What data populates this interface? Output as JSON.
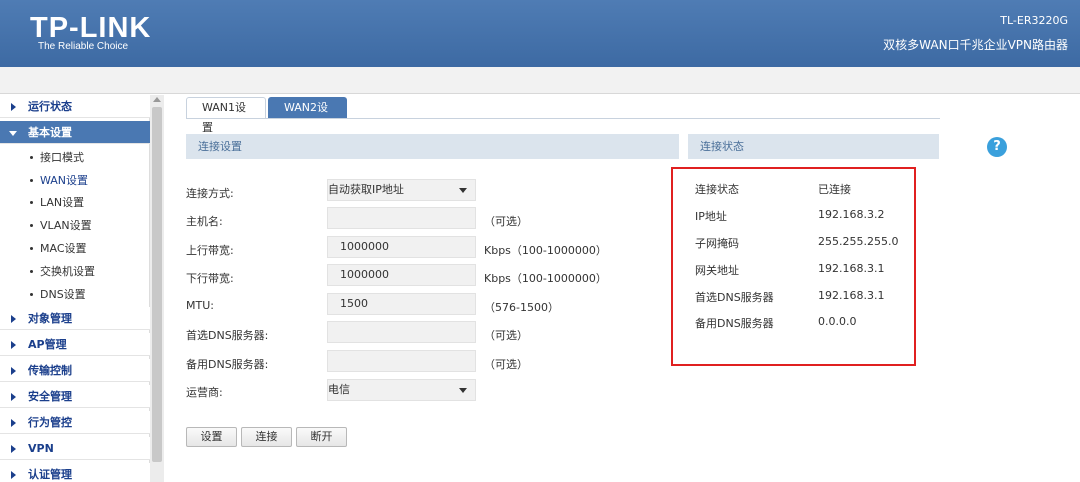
{
  "header": {
    "logo": "TP-LINK",
    "slogan": "The Reliable Choice",
    "model": "TL-ER3220G",
    "description": "双核多WAN口千兆企业VPN路由器"
  },
  "sidebar": {
    "groups": [
      {
        "label": "运行状态",
        "expanded": false
      },
      {
        "label": "基本设置",
        "expanded": true,
        "items": [
          "接口模式",
          "WAN设置",
          "LAN设置",
          "VLAN设置",
          "MAC设置",
          "交换机设置",
          "DNS设置"
        ]
      },
      {
        "label": "对象管理",
        "expanded": false
      },
      {
        "label": "AP管理",
        "expanded": false
      },
      {
        "label": "传输控制",
        "expanded": false
      },
      {
        "label": "安全管理",
        "expanded": false
      },
      {
        "label": "行为管控",
        "expanded": false
      },
      {
        "label": "VPN",
        "expanded": false
      },
      {
        "label": "认证管理",
        "expanded": false
      }
    ],
    "active_item": "WAN设置"
  },
  "tabs": [
    {
      "label": "WAN1设置",
      "active": false
    },
    {
      "label": "WAN2设置",
      "active": true
    }
  ],
  "connection_settings": {
    "title": "连接设置",
    "fields": [
      {
        "label": "连接方式:",
        "value": "自动获取IP地址",
        "type": "select",
        "hint": ""
      },
      {
        "label": "主机名:",
        "value": "",
        "type": "text",
        "hint": "（可选）"
      },
      {
        "label": "上行带宽:",
        "value": "1000000",
        "type": "text",
        "hint": "Kbps（100-1000000）"
      },
      {
        "label": "下行带宽:",
        "value": "1000000",
        "type": "text",
        "hint": "Kbps（100-1000000）"
      },
      {
        "label": "MTU:",
        "value": "1500",
        "type": "text",
        "hint": "（576-1500）"
      },
      {
        "label": "首选DNS服务器:",
        "value": "",
        "type": "text",
        "hint": "（可选）"
      },
      {
        "label": "备用DNS服务器:",
        "value": "",
        "type": "text",
        "hint": "（可选）"
      },
      {
        "label": "运营商:",
        "value": "电信",
        "type": "select",
        "hint": ""
      }
    ],
    "buttons": {
      "save": "设置",
      "connect": "连接",
      "disconnect": "断开"
    }
  },
  "connection_status": {
    "title": "连接状态",
    "rows": [
      {
        "label": "连接状态",
        "value": "已连接"
      },
      {
        "label": "IP地址",
        "value": "192.168.3.2"
      },
      {
        "label": "子网掩码",
        "value": "255.255.255.0"
      },
      {
        "label": "网关地址",
        "value": "192.168.3.1"
      },
      {
        "label": "首选DNS服务器",
        "value": "192.168.3.1"
      },
      {
        "label": "备用DNS服务器",
        "value": "0.0.0.0"
      }
    ]
  },
  "help_label": "?",
  "colors": {
    "header": "#4a78b2",
    "nav_text": "#1b3f8c",
    "highlight_box": "#e02020",
    "help_icon": "#3aa0dc"
  }
}
